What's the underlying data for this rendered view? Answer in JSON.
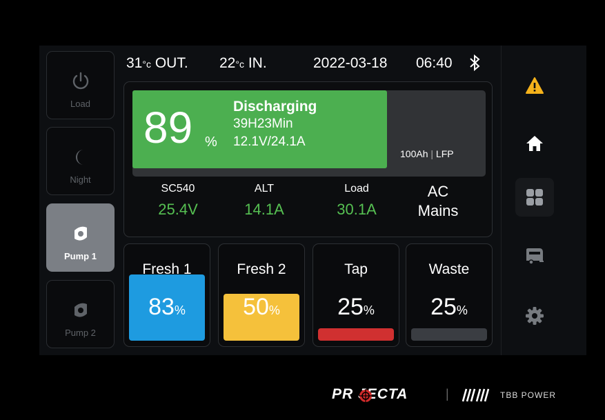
{
  "status": {
    "out_temp": "31",
    "out_unit": "°c",
    "out_label": "OUT.",
    "in_temp": "22",
    "in_unit": "°c",
    "in_label": "IN.",
    "date": "2022-03-18",
    "time": "06:40"
  },
  "left_buttons": [
    {
      "label": "Load"
    },
    {
      "label": "Night"
    },
    {
      "label": "Pump 1"
    },
    {
      "label": "Pump 2"
    }
  ],
  "battery": {
    "percent": "89",
    "percent_sign": "%",
    "state": "Discharging",
    "time_remaining": "39H23Min",
    "voltage_current": "12.1V/24.1A",
    "capacity": "100Ah",
    "capacity_sep": "|",
    "chemistry": "LFP",
    "fill_fraction": 0.89
  },
  "stats": [
    {
      "title": "SC540",
      "value": "25.4V"
    },
    {
      "title": "ALT",
      "value": "14.1A"
    },
    {
      "title": "Load",
      "value": "30.1A"
    }
  ],
  "ac": {
    "line1": "AC",
    "line2": "Mains"
  },
  "tanks": [
    {
      "name": "Fresh 1",
      "value": "83",
      "unit": "%",
      "level": 0.83,
      "color": "#1e9be0"
    },
    {
      "name": "Fresh 2",
      "value": "50",
      "unit": "%",
      "level": 0.5,
      "color": "#f5c13b"
    },
    {
      "name": "Tap",
      "value": "25",
      "unit": "%",
      "level": 0.25,
      "color": "#d03030"
    },
    {
      "name": "Waste",
      "value": "25",
      "unit": "%",
      "level": 0.25,
      "color": "#3a3d42"
    }
  ],
  "nav_icons": [
    "warning-icon",
    "home-icon",
    "grid-icon",
    "caravan-icon",
    "gear-icon"
  ],
  "colors": {
    "accent_green": "#4caf50",
    "value_green": "#56c052",
    "warning": "#f5b21b"
  },
  "footer": {
    "brand": "PR JECTA",
    "brand_partner": "TBB POWER"
  }
}
